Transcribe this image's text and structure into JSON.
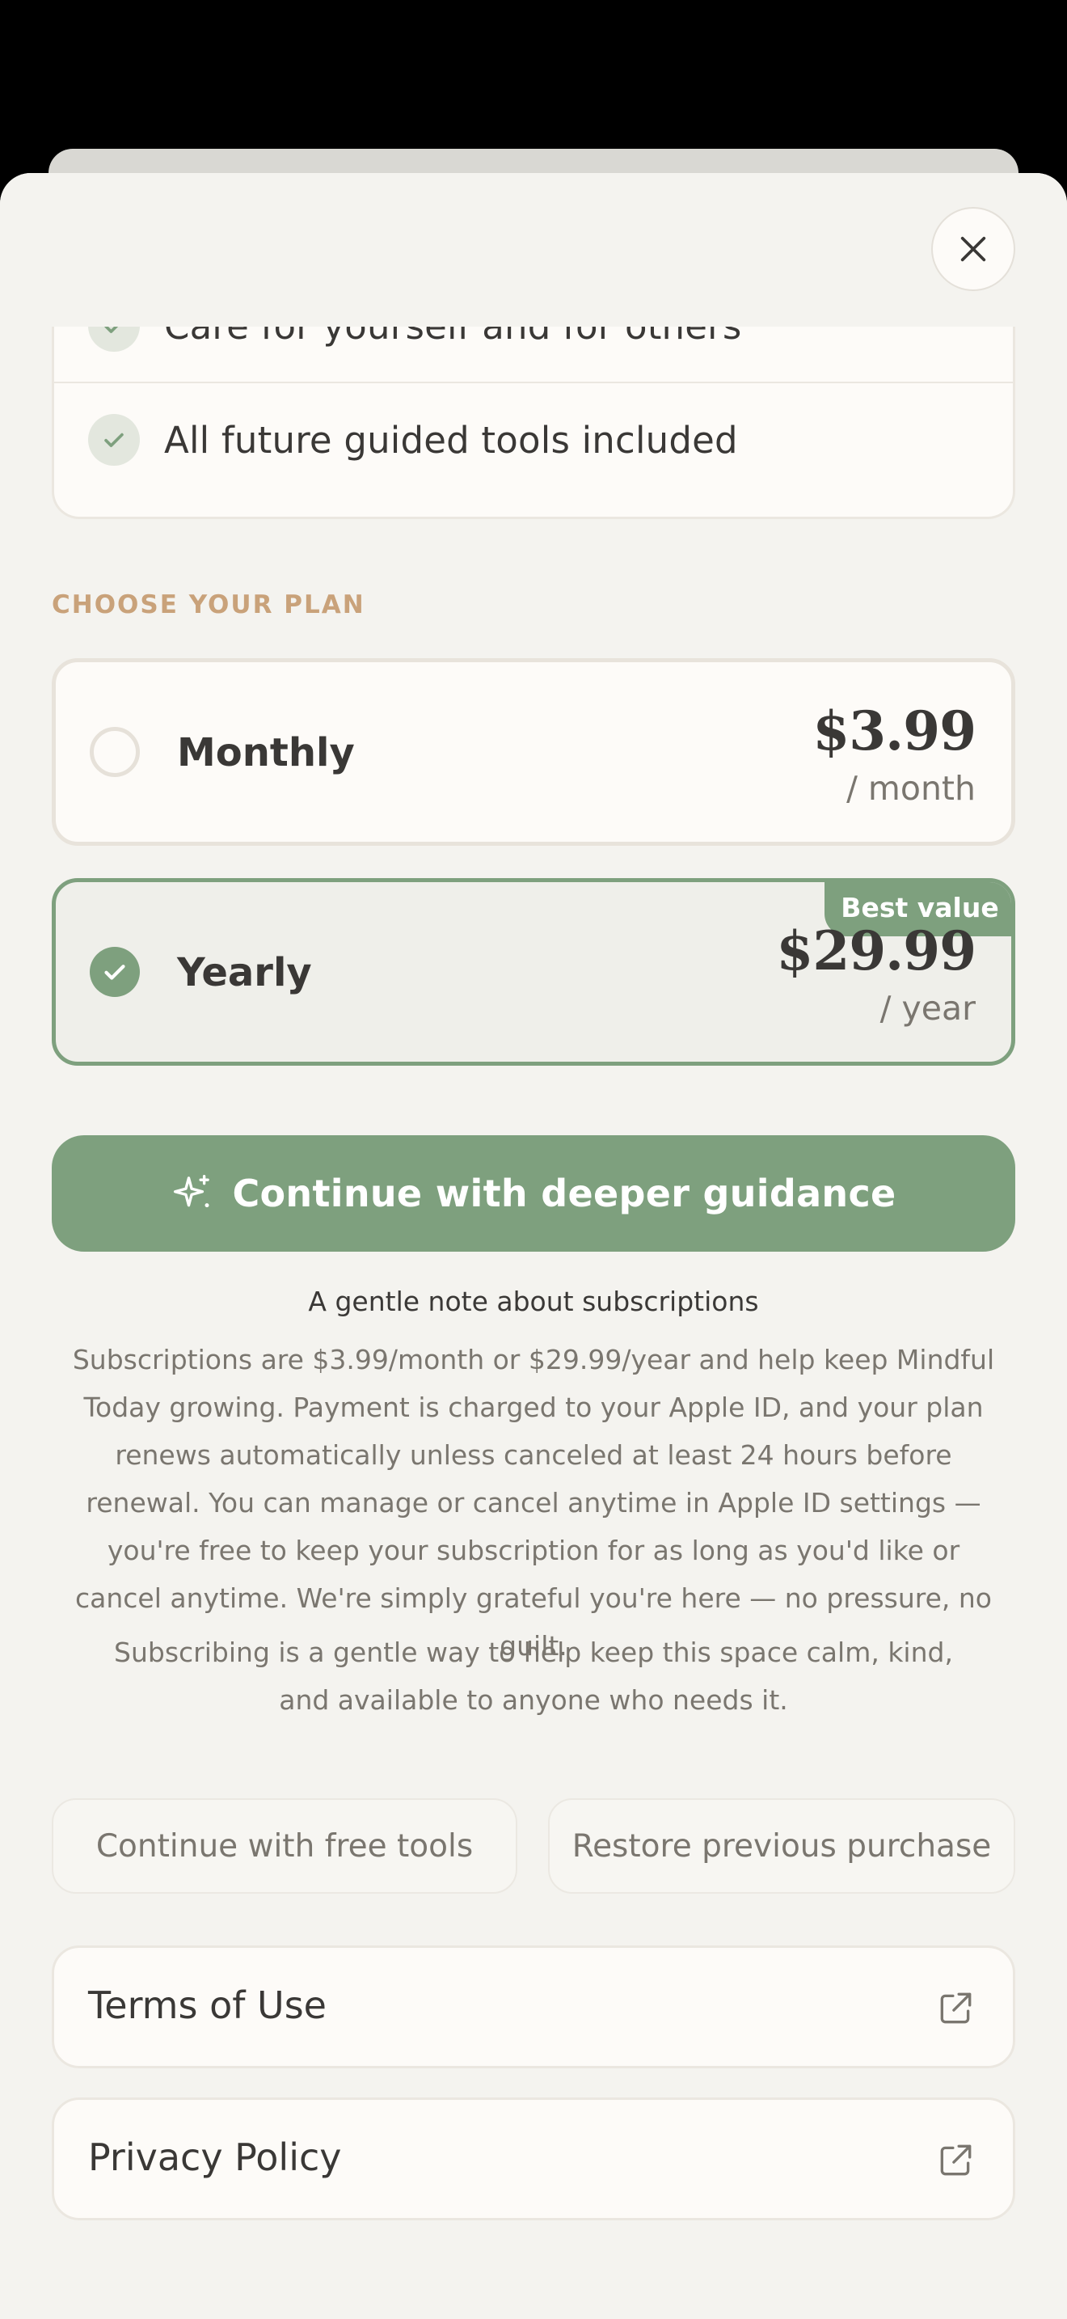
{
  "features": [
    {
      "label": "Care for yourself and for others",
      "icon": "check-icon"
    },
    {
      "label": "All future guided tools included",
      "icon": "check-icon"
    }
  ],
  "close": {
    "icon": "close-icon"
  },
  "plans_section": {
    "label": "CHOOSE YOUR PLAN"
  },
  "plans": {
    "monthly": {
      "name": "Monthly",
      "price": "$3.99",
      "period": "/ month",
      "selected": false
    },
    "yearly": {
      "name": "Yearly",
      "price": "$29.99",
      "period": "/ year",
      "badge": "Best value",
      "selected": true
    }
  },
  "cta": {
    "label": "Continue with deeper guidance",
    "icon": "sparkle-icon"
  },
  "note": {
    "title": "A gentle note about subscriptions",
    "body": "Subscriptions are $3.99/month or $29.99/year and help keep Mindful Today growing. Payment is charged to your Apple ID, and your plan renews automatically unless canceled at least 24 hours before renewal. You can manage or cancel anytime in Apple ID settings — you're free to keep your subscription for as long as you'd like or cancel anytime. We're simply grateful you're here — no pressure, no guilt.",
    "body2": "Subscribing is a gentle way to help keep this space calm, kind, and available to anyone who needs it."
  },
  "secondary": {
    "free_label": "Continue with free tools",
    "restore_label": "Restore previous purchase"
  },
  "links": {
    "terms_label": "Terms of Use",
    "privacy_label": "Privacy Policy",
    "icon": "external-link-icon"
  },
  "colors": {
    "accent": "#7ea07e",
    "section_label": "#c9a27a",
    "background": "#f4f3ef",
    "card": "#fdfbf8"
  }
}
